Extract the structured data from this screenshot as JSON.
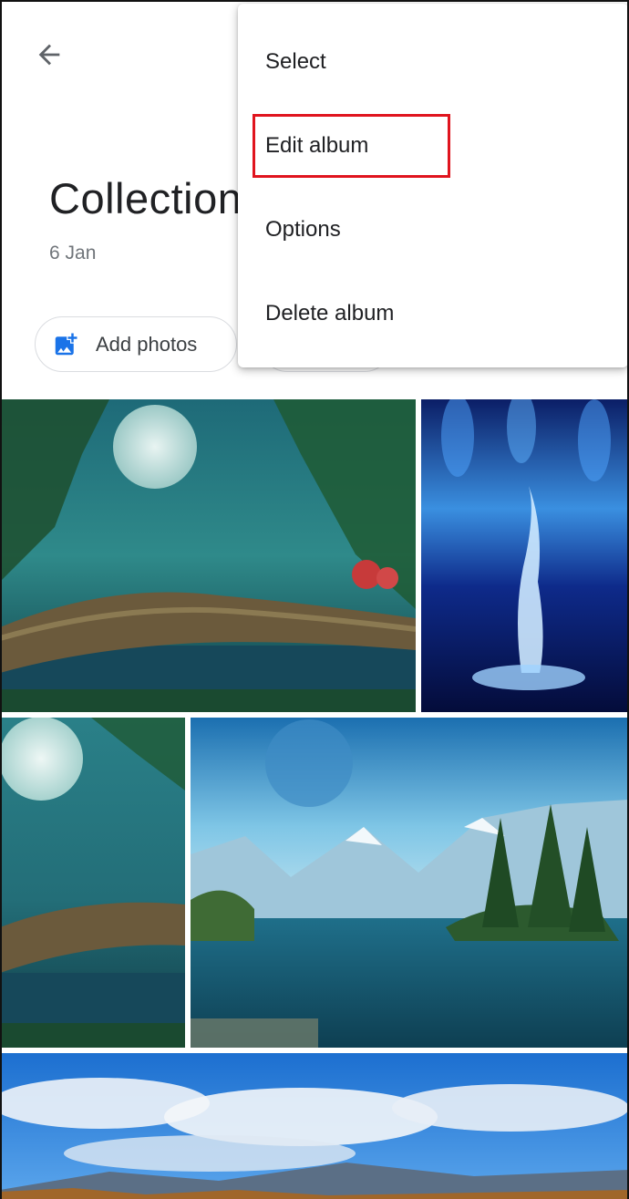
{
  "header": {
    "back_icon": "arrow-left-icon"
  },
  "album": {
    "title": "Collection",
    "date": "6 Jan"
  },
  "actions": {
    "add_photos_label": "Add photos",
    "add_photos_icon": "add-photo-icon"
  },
  "menu": {
    "items": [
      {
        "label": "Select"
      },
      {
        "label": "Edit album"
      },
      {
        "label": "Options"
      },
      {
        "label": "Delete album"
      }
    ],
    "highlighted_index": 1,
    "highlight_color": "#e0141e"
  },
  "photos": [
    {
      "name": "fantasy-forest-moon"
    },
    {
      "name": "blue-water-fountain"
    },
    {
      "name": "fantasy-forest-moon-crop"
    },
    {
      "name": "mountain-lake-island"
    },
    {
      "name": "cloudy-sky-mountains"
    }
  ],
  "colors": {
    "accent": "#1a73e8",
    "text_primary": "#202124",
    "text_secondary": "#70757a",
    "chip_border": "#dadce0"
  }
}
